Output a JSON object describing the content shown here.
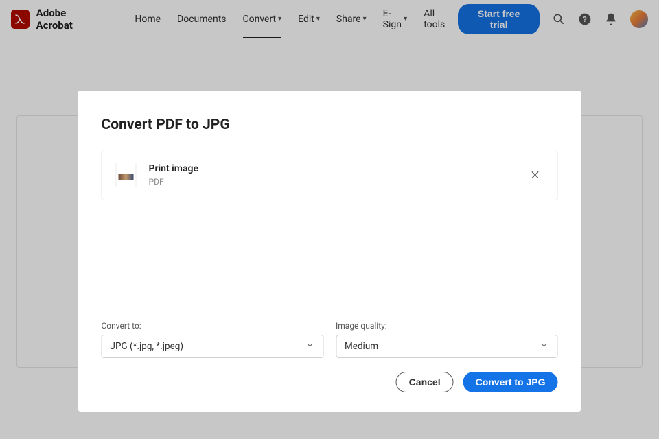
{
  "brand": "Adobe Acrobat",
  "nav": {
    "items": [
      {
        "label": "Home",
        "dropdown": false
      },
      {
        "label": "Documents",
        "dropdown": false
      },
      {
        "label": "Convert",
        "dropdown": true,
        "active": true
      },
      {
        "label": "Edit",
        "dropdown": true
      },
      {
        "label": "Share",
        "dropdown": true
      },
      {
        "label": "E-Sign",
        "dropdown": true
      },
      {
        "label": "All tools",
        "dropdown": false
      }
    ]
  },
  "trial_button": "Start free trial",
  "modal": {
    "title": "Convert PDF to JPG",
    "file": {
      "name": "Print image",
      "type": "PDF"
    },
    "convert_to": {
      "label": "Convert to:",
      "value": "JPG (*.jpg, *.jpeg)"
    },
    "quality": {
      "label": "Image quality:",
      "value": "Medium"
    },
    "actions": {
      "cancel": "Cancel",
      "confirm": "Convert to JPG"
    }
  }
}
